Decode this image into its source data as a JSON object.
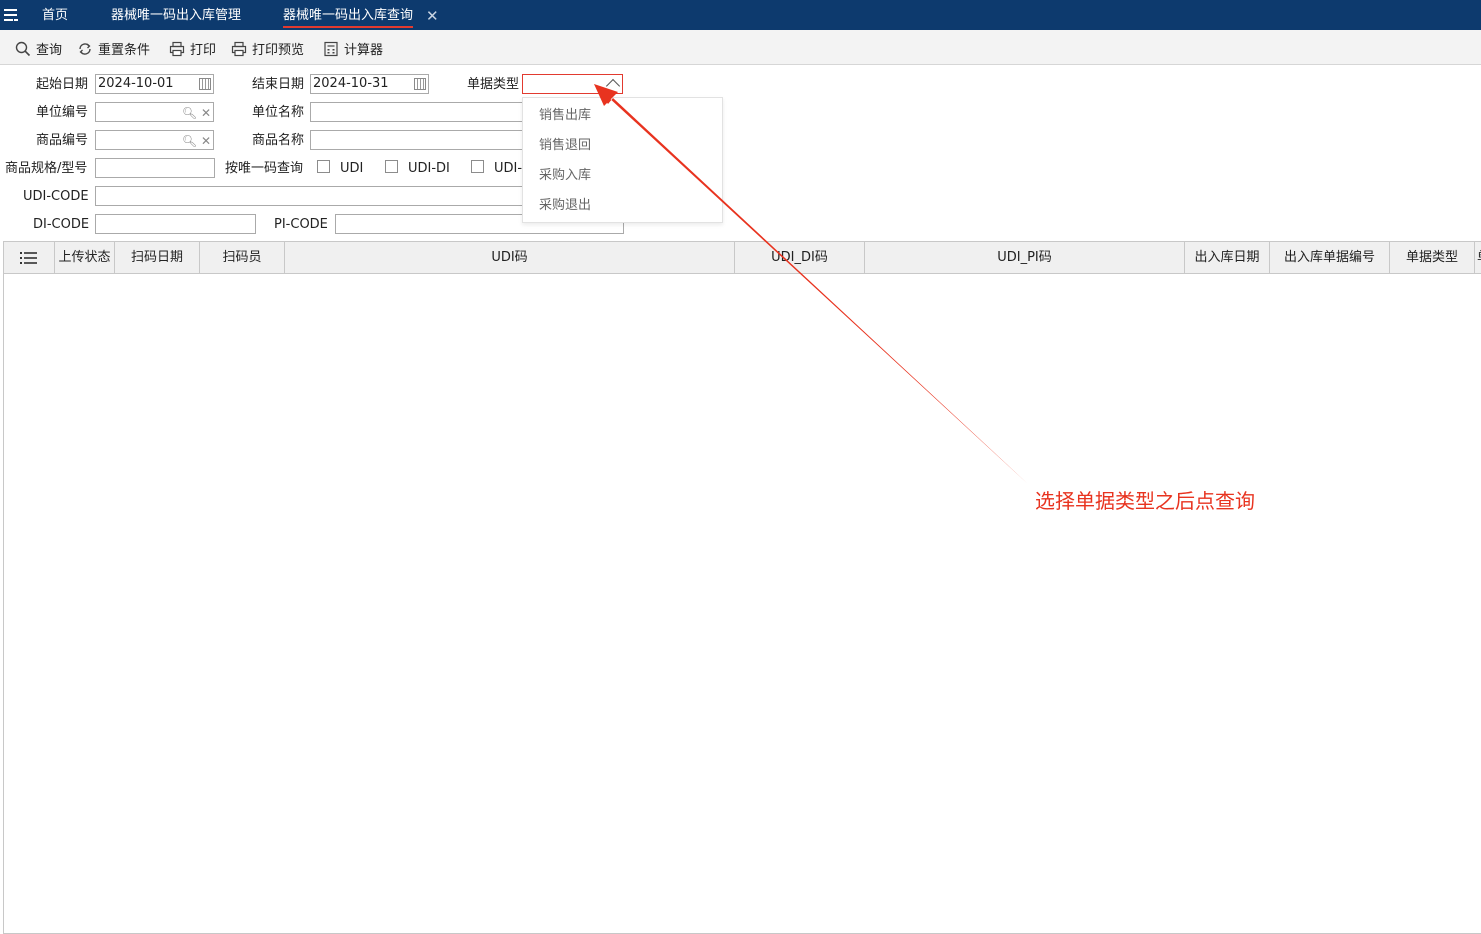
{
  "tabs": {
    "menu_icon": "hamburger-icon",
    "home": "首页",
    "manage": "器械唯一码出入库管理",
    "query": "器械唯一码出入库查询",
    "close_glyph": "✕"
  },
  "toolbar": {
    "query": "查询",
    "reset": "重置条件",
    "print": "打印",
    "print_preview": "打印预览",
    "calculator": "计算器"
  },
  "form": {
    "start_date_label": "起始日期",
    "start_date_value": "2024-10-01",
    "end_date_label": "结束日期",
    "end_date_value": "2024-10-31",
    "doc_type_label": "单据类型",
    "doc_type_value": "",
    "unit_code_label": "单位编号",
    "unit_name_label": "单位名称",
    "goods_code_label": "商品编号",
    "goods_name_label": "商品名称",
    "spec_label": "商品规格/型号",
    "by_udi_label": "按唯一码查询",
    "chk_udi": "UDI",
    "chk_udi_di": "UDI-DI",
    "chk_udi_pi": "UDI-",
    "udi_code_label": "UDI-CODE",
    "di_code_label": "DI-CODE",
    "pi_code_label": "PI-CODE",
    "search_glyph": "🔍︎",
    "clear_glyph": "✕"
  },
  "dropdown": {
    "options": [
      "销售出库",
      "销售退回",
      "采购入库",
      "采购退出"
    ]
  },
  "grid": {
    "columns": [
      "上传状态",
      "扫码日期",
      "扫码员",
      "UDI码",
      "UDI_DI码",
      "UDI_PI码",
      "出入库日期",
      "出入库单据编号",
      "单据类型",
      "单"
    ]
  },
  "annotation": {
    "text": "选择单据类型之后点查询",
    "color": "#e8331f"
  },
  "colors": {
    "header_bg": "#0d3a6e",
    "accent": "#e23a2f"
  }
}
